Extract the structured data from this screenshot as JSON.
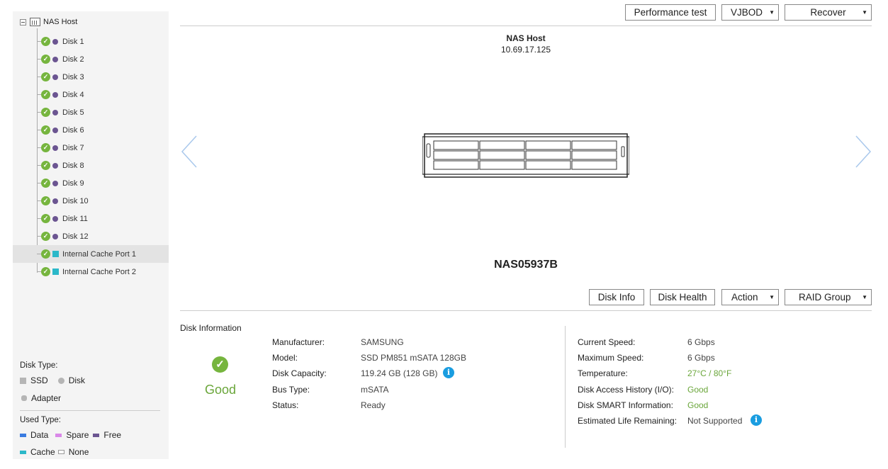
{
  "toolbar": {
    "performance_test": "Performance test",
    "vjbod": "VJBOD",
    "recover": "Recover"
  },
  "tree": {
    "root_label": "NAS Host",
    "items": [
      {
        "label": "Disk 1",
        "type": "disk"
      },
      {
        "label": "Disk 2",
        "type": "disk"
      },
      {
        "label": "Disk 3",
        "type": "disk"
      },
      {
        "label": "Disk 4",
        "type": "disk"
      },
      {
        "label": "Disk 5",
        "type": "disk"
      },
      {
        "label": "Disk 6",
        "type": "disk"
      },
      {
        "label": "Disk 7",
        "type": "disk"
      },
      {
        "label": "Disk 8",
        "type": "disk"
      },
      {
        "label": "Disk 9",
        "type": "disk"
      },
      {
        "label": "Disk 10",
        "type": "disk"
      },
      {
        "label": "Disk 11",
        "type": "disk"
      },
      {
        "label": "Disk 12",
        "type": "disk"
      },
      {
        "label": "Internal Cache Port 1",
        "type": "cache",
        "selected": true
      },
      {
        "label": "Internal Cache Port 2",
        "type": "cache"
      }
    ]
  },
  "legend": {
    "disk_type_title": "Disk Type:",
    "ssd": "SSD",
    "disk": "Disk",
    "adapter": "Adapter",
    "used_type_title": "Used Type:",
    "data": "Data",
    "spare": "Spare",
    "free": "Free",
    "cache": "Cache",
    "none": "None",
    "colors": {
      "ssd": "#b5b5b5",
      "disk": "#b5b5b5",
      "adapter": "#b5b5b5",
      "data": "#3a7be0",
      "spare": "#d988e8",
      "free": "#6b5591",
      "cache": "#2bb8c9",
      "none": "#ffffff"
    }
  },
  "enclosure": {
    "host_name": "NAS Host",
    "host_ip": "10.69.17.125",
    "model": "NAS05937B"
  },
  "disk_toolbar": {
    "disk_info": "Disk Info",
    "disk_health": "Disk Health",
    "action": "Action",
    "raid_group": "RAID Group"
  },
  "disk_information": {
    "title": "Disk Information",
    "status_word": "Good",
    "left": {
      "manufacturer_label": "Manufacturer:",
      "manufacturer": "SAMSUNG",
      "model_label": "Model:",
      "model": "SSD PM851 mSATA 128GB",
      "capacity_label": "Disk Capacity:",
      "capacity": "119.24 GB (128 GB)",
      "bus_label": "Bus Type:",
      "bus": "mSATA",
      "status_label": "Status:",
      "status": "Ready"
    },
    "right": {
      "current_speed_label": "Current Speed:",
      "current_speed": "6 Gbps",
      "max_speed_label": "Maximum Speed:",
      "max_speed": "6 Gbps",
      "temperature_label": "Temperature:",
      "temperature": "27°C / 80°F",
      "access_history_label": "Disk Access History (I/O):",
      "access_history": "Good",
      "smart_label": "Disk SMART Information:",
      "smart": "Good",
      "life_label": "Estimated Life Remaining:",
      "life": "Not Supported"
    }
  }
}
